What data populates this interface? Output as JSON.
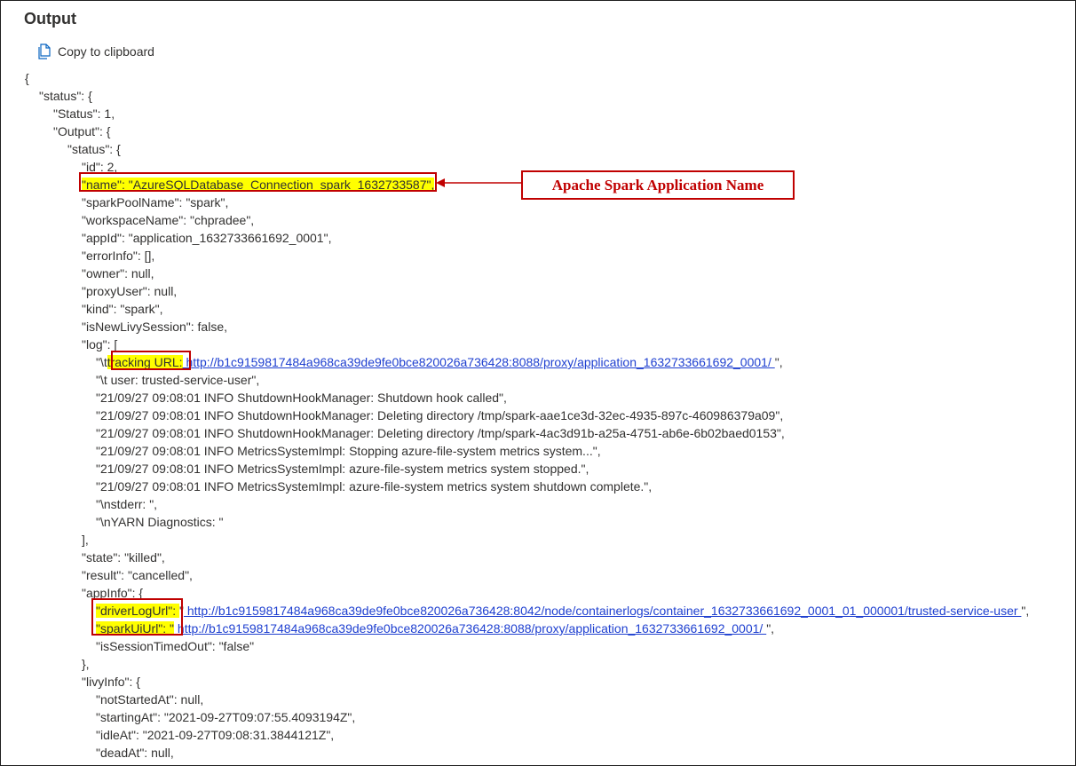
{
  "header": {
    "title": "Output",
    "copy_label": "Copy to clipboard",
    "copy_icon": "copy-icon"
  },
  "colors": {
    "highlight": "#ffff00",
    "annotation_red": "#c00000",
    "link": "#1f40d0"
  },
  "annotation": {
    "label": "Apache Spark Application Name"
  },
  "lines": [
    "{",
    "\"status\": {",
    "\"Status\": 1,",
    "\"Output\": {",
    "\"status\": {",
    "\"id\": 2,",
    {
      "hl": "\"name\": \"AzureSQLDatabase_Connection_spark_1632733587\","
    },
    "\"sparkPoolName\": \"spark\",",
    "\"workspaceName\": \"chpradee\",",
    "\"appId\": \"application_1632733661692_0001\",",
    "\"errorInfo\": [],",
    "\"owner\": null,",
    "\"proxyUser\": null,",
    "\"kind\": \"spark\",",
    "\"isNewLivySession\": false,",
    "\"log\": [",
    {
      "pre": "\"\\t",
      "hl": "tracking URL:",
      "url": " http://b1c9159817484a968ca39de9fe0bce820026a736428:8088/proxy/application_1632733661692_0001/ ",
      "post": "\","
    },
    "\"\\t user: trusted-service-user\",",
    "\"21/09/27 09:08:01 INFO ShutdownHookManager: Shutdown hook called\",",
    "\"21/09/27 09:08:01 INFO ShutdownHookManager: Deleting directory /tmp/spark-aae1ce3d-32ec-4935-897c-460986379a09\",",
    "\"21/09/27 09:08:01 INFO ShutdownHookManager: Deleting directory /tmp/spark-4ac3d91b-a25a-4751-ab6e-6b02baed0153\",",
    "\"21/09/27 09:08:01 INFO MetricsSystemImpl: Stopping azure-file-system metrics system...\",",
    "\"21/09/27 09:08:01 INFO MetricsSystemImpl: azure-file-system metrics system stopped.\",",
    "\"21/09/27 09:08:01 INFO MetricsSystemImpl: azure-file-system metrics system shutdown complete.\",",
    "\"\\nstderr: \",",
    "\"\\nYARN Diagnostics: \"",
    "],",
    "\"state\": \"killed\",",
    "\"result\": \"cancelled\",",
    "\"appInfo\": {",
    {
      "hl": "\"driverLogUrl\": ",
      "pre2": "\"",
      "url": " http://b1c9159817484a968ca39de9fe0bce820026a736428:8042/node/containerlogs/container_1632733661692_0001_01_000001/trusted-service-user ",
      "post": "\","
    },
    {
      "hl": "\"sparkUiUrl\": \"",
      "url": " http://b1c9159817484a968ca39de9fe0bce820026a736428:8088/proxy/application_1632733661692_0001/ ",
      "post": "\","
    },
    "\"isSessionTimedOut\": \"false\"",
    "},",
    "\"livyInfo\": {",
    "\"notStartedAt\": null,",
    "\"startingAt\": \"2021-09-27T09:07:55.4093194Z\",",
    "\"idleAt\": \"2021-09-27T09:08:31.3844121Z\",",
    "\"deadAt\": null,"
  ]
}
